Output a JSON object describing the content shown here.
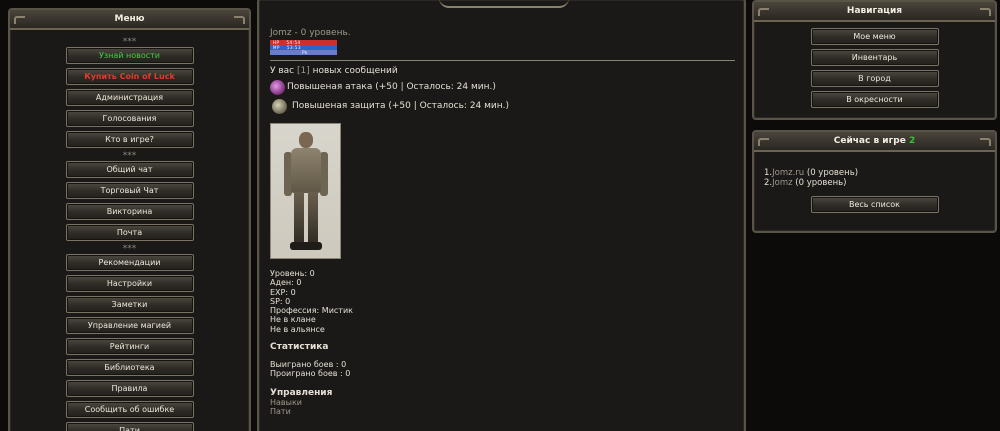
{
  "left_menu": {
    "title": "Меню",
    "separator": "***",
    "group1": [
      "Узнай новости",
      "Купить Coin of Luck",
      "Администрация",
      "Голосования",
      "Кто в игре?"
    ],
    "group2": [
      "Общий чат",
      "Торговый Чат",
      "Викторина",
      "Почта"
    ],
    "group3": [
      "Рекомендации",
      "Настройки",
      "Заметки",
      "Управление магией",
      "Рейтинги",
      "Библиотека",
      "Правила",
      "Сообщить об ошибке",
      "Пати"
    ]
  },
  "player": {
    "name": "Jomz",
    "level_text": " - 0 уровень.",
    "hp_label": "HP",
    "hp_value": "54:54",
    "mp_label": "MP",
    "mp_value": "53:53",
    "pk_label": "Pk"
  },
  "messages": {
    "prefix": "У вас ",
    "count": "[1]",
    "suffix": " новых сообщений"
  },
  "buffs": [
    {
      "icon": "attack-buff-icon",
      "text": "Повышеная атака (+50 | Осталось: 24 мин.)"
    },
    {
      "icon": "defense-buff-icon",
      "text": "Повышеная защита (+50 | Осталось: 24 мин.)"
    }
  ],
  "stats": [
    "Уровень: 0",
    "Аден: 0",
    "EXP: 0",
    "SP: 0",
    "Профессия: Мистик",
    "Не в клане",
    "Не в альянсе"
  ],
  "statistics": {
    "title": "Статистика",
    "wins": "Выиграно боев : 0",
    "losses": "Проиграно боев : 0"
  },
  "controls": {
    "title": "Управления",
    "links": [
      "Навыки",
      "Пати"
    ]
  },
  "navigation": {
    "title": "Навигация",
    "items": [
      "Мое меню",
      "Инвентарь",
      "В город",
      "В окресности"
    ]
  },
  "online": {
    "title": "Сейчас в игре",
    "title_count": "2",
    "rows": [
      {
        "num": "1.",
        "name": "Jomz.ru",
        "level": " (0 уровень)"
      },
      {
        "num": "2.",
        "name": "Jomz",
        "level": " (0 уровень)"
      }
    ],
    "all_list": "Весь список"
  }
}
